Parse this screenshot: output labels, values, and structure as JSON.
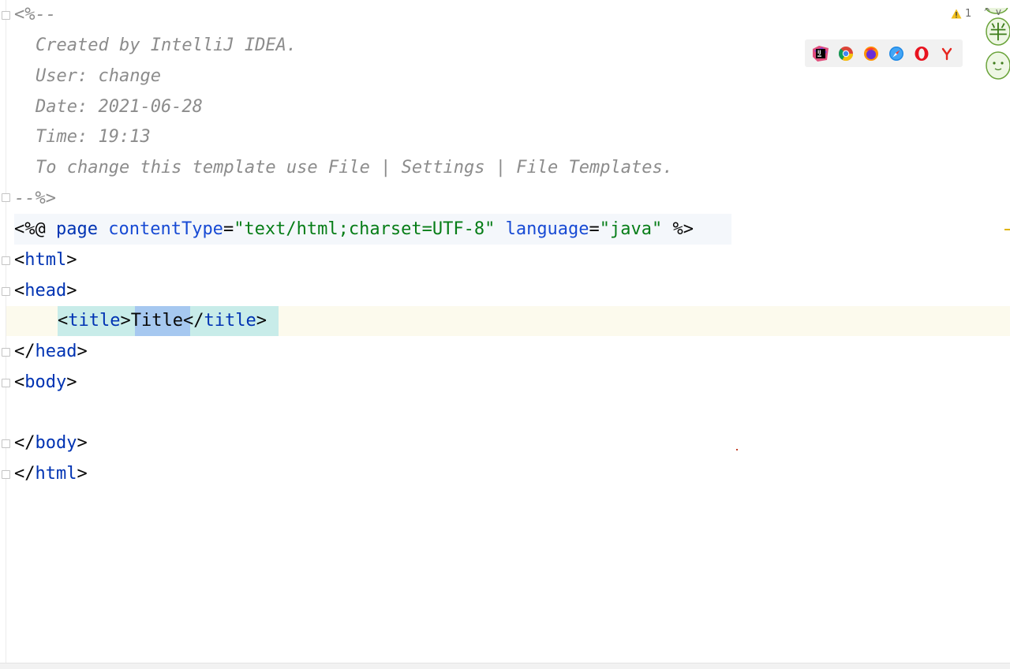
{
  "editor": {
    "comment": {
      "open": "<%--",
      "created": "Created by IntelliJ IDEA.",
      "user": "User: change",
      "date": "Date: 2021-06-28",
      "time": "Time: 19:13",
      "template": "To change this template use File | Settings | File Templates.",
      "close": "--%>"
    },
    "directive": {
      "open": "<%@",
      "keyword": "page",
      "attr1": "contentType",
      "value1": "\"text/html;charset=UTF-8\"",
      "attr2": "language",
      "value2": "\"java\"",
      "close": "%>"
    },
    "html_tag": "html",
    "head_tag": "head",
    "title_tag": "title",
    "title_text": "Title",
    "body_tag": "body",
    "lt": "<",
    "gt": ">",
    "lts": "</",
    "eq": "="
  },
  "inspections": {
    "warning_count": "1",
    "nav_arrows": "^ v"
  },
  "browsers": [
    "jetbrains-icon",
    "chrome-icon",
    "firefox-icon",
    "safari-icon",
    "opera-icon",
    "yandex-icon"
  ],
  "mascot": {
    "glyph": "半"
  },
  "colors": {
    "tag": "#0033b3",
    "attribute": "#174ad4",
    "string": "#067d17",
    "comment": "#8c8c8c",
    "caret_row": "#fcfaed",
    "tag_highlight": "#c8ece9",
    "word_highlight": "#a6c8f0"
  }
}
